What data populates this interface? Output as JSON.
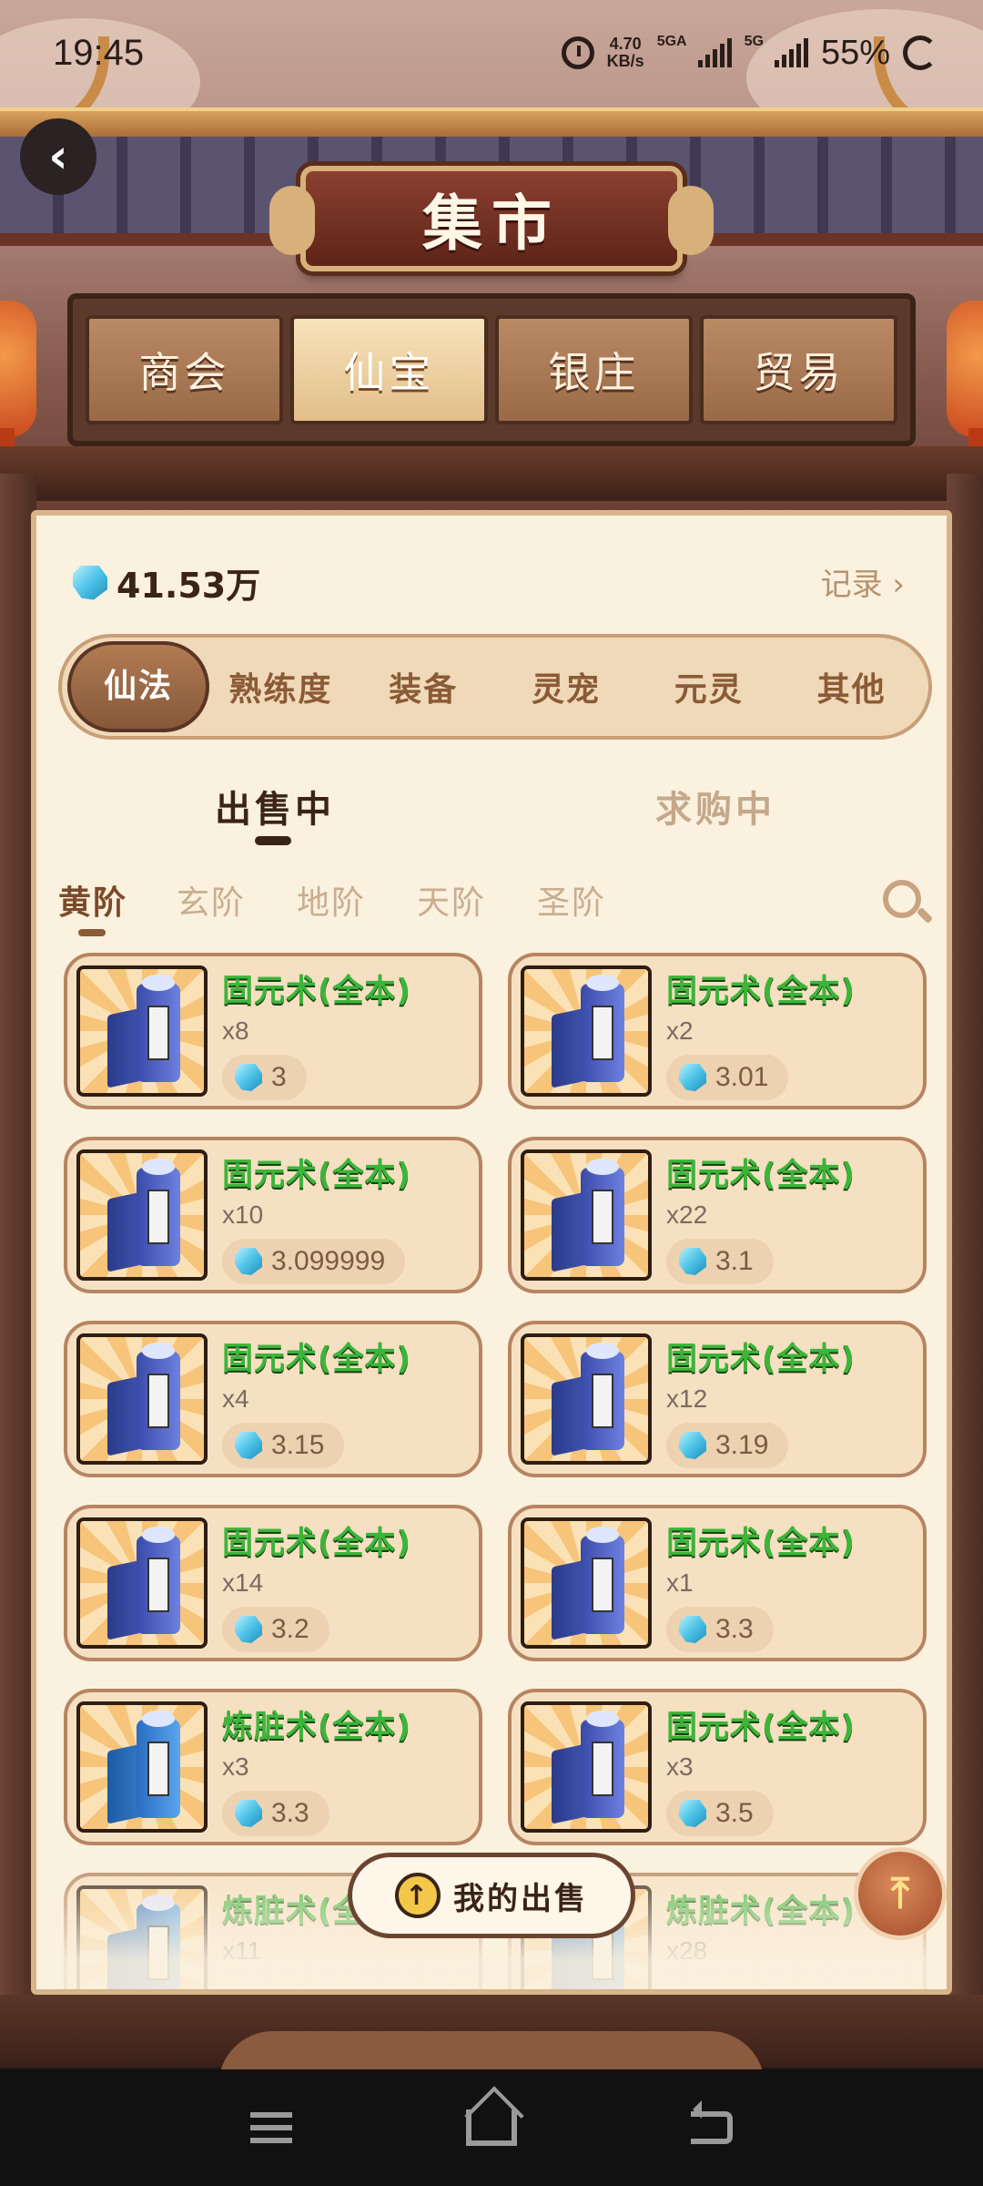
{
  "status_bar": {
    "time": "19:45",
    "net_speed_value": "4.70",
    "net_speed_unit": "KB/s",
    "signal1_label": "5GA",
    "signal2_label": "5G",
    "battery": "55%"
  },
  "header": {
    "title": "集市",
    "back_icon": "chevron-left-icon"
  },
  "main_tabs": [
    {
      "label": "商会",
      "active": false
    },
    {
      "label": "仙宝",
      "active": true
    },
    {
      "label": "银庄",
      "active": false
    },
    {
      "label": "贸易",
      "active": false
    }
  ],
  "balance": {
    "value": "41.53万",
    "currency_icon": "gem-icon"
  },
  "records_label": "记录 ›",
  "categories": [
    {
      "label": "仙法",
      "active": true
    },
    {
      "label": "熟练度",
      "active": false
    },
    {
      "label": "装备",
      "active": false
    },
    {
      "label": "灵宠",
      "active": false
    },
    {
      "label": "元灵",
      "active": false
    },
    {
      "label": "其他",
      "active": false
    }
  ],
  "market_tabs": [
    {
      "label": "出售中",
      "active": true
    },
    {
      "label": "求购中",
      "active": false
    }
  ],
  "tiers": [
    {
      "label": "黄阶",
      "active": true
    },
    {
      "label": "玄阶",
      "active": false
    },
    {
      "label": "地阶",
      "active": false
    },
    {
      "label": "天阶",
      "active": false
    },
    {
      "label": "圣阶",
      "active": false
    }
  ],
  "items": [
    {
      "name": "固元术(全本)",
      "qty": "x8",
      "price": "3"
    },
    {
      "name": "固元术(全本)",
      "qty": "x2",
      "price": "3.01"
    },
    {
      "name": "固元术(全本)",
      "qty": "x10",
      "price": "3.099999"
    },
    {
      "name": "固元术(全本)",
      "qty": "x22",
      "price": "3.1"
    },
    {
      "name": "固元术(全本)",
      "qty": "x4",
      "price": "3.15"
    },
    {
      "name": "固元术(全本)",
      "qty": "x12",
      "price": "3.19"
    },
    {
      "name": "固元术(全本)",
      "qty": "x14",
      "price": "3.2"
    },
    {
      "name": "固元术(全本)",
      "qty": "x1",
      "price": "3.3"
    },
    {
      "name": "炼脏术(全本)",
      "qty": "x3",
      "price": "3.3"
    },
    {
      "name": "固元术(全本)",
      "qty": "x3",
      "price": "3.5"
    },
    {
      "name": "炼脏术(全本)",
      "qty": "x11",
      "price": ""
    },
    {
      "name": "炼脏术(全本)",
      "qty": "x28",
      "price": ""
    }
  ],
  "my_sales_label": "我的出售",
  "colors": {
    "item_name": "#3cb53a",
    "accent_wood": "#86573a",
    "panel_bg": "#fbf1df"
  }
}
